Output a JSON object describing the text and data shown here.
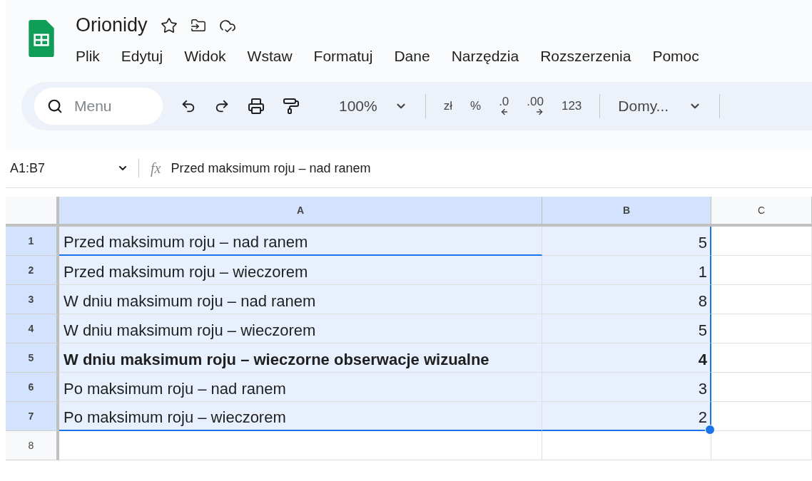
{
  "document": {
    "title": "Orionidy"
  },
  "menu": [
    "Plik",
    "Edytuj",
    "Widok",
    "Wstaw",
    "Formatuj",
    "Dane",
    "Narzędzia",
    "Rozszerzenia",
    "Pomoc"
  ],
  "toolbar": {
    "search": {
      "placeholder": "Menu"
    },
    "zoom": "100%",
    "currency": "zł",
    "percent": "%",
    "decrease_decimals": ".0",
    "increase_decimals": ".00",
    "number_format": "123",
    "font": "Domy..."
  },
  "formula_bar": {
    "name_box": "A1:B7",
    "fx_label": "fx",
    "formula": "Przed maksimum roju – nad ranem"
  },
  "columns": [
    {
      "label": "A",
      "selected": true
    },
    {
      "label": "B",
      "selected": true
    },
    {
      "label": "C",
      "selected": false
    }
  ],
  "rows": [
    {
      "number": "1",
      "selected": true,
      "bold": false,
      "cells": [
        "Przed maksimum roju – nad ranem",
        "5"
      ]
    },
    {
      "number": "2",
      "selected": true,
      "bold": false,
      "cells": [
        "Przed maksimum roju – wieczorem",
        "1"
      ]
    },
    {
      "number": "3",
      "selected": true,
      "bold": false,
      "cells": [
        "W dniu maksimum roju – nad ranem",
        "8"
      ]
    },
    {
      "number": "4",
      "selected": true,
      "bold": false,
      "cells": [
        "W dniu maksimum roju – wieczorem",
        "5"
      ]
    },
    {
      "number": "5",
      "selected": true,
      "bold": true,
      "cells": [
        "W dniu maksimum roju – wieczorne obserwacje wizualne",
        "4"
      ]
    },
    {
      "number": "6",
      "selected": true,
      "bold": false,
      "cells": [
        "Po maksimum roju – nad ranem",
        "3"
      ]
    },
    {
      "number": "7",
      "selected": true,
      "bold": false,
      "cells": [
        "Po maksimum roju – wieczorem",
        "2"
      ]
    },
    {
      "number": "8",
      "selected": false
    }
  ]
}
